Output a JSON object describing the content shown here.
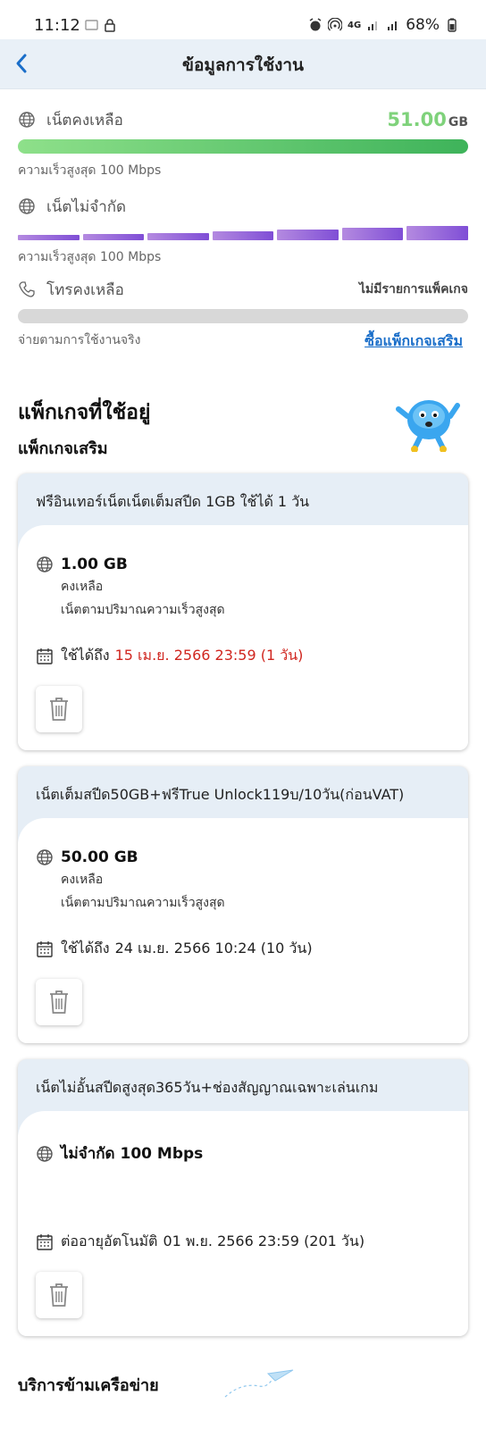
{
  "status_bar": {
    "time": "11:12",
    "battery": "68%",
    "network": "4G"
  },
  "header": {
    "title": "ข้อมูลการใช้งาน"
  },
  "usage": {
    "internet_remaining": {
      "label": "เน็ตคงเหลือ",
      "amount": "51.00",
      "unit": "GB",
      "speed": "ความเร็วสูงสุด 100 Mbps",
      "fill_fraction": 1.0
    },
    "unlimited": {
      "label": "เน็ตไม่จำกัด",
      "speed": "ความเร็วสูงสุด 100 Mbps"
    },
    "call_remaining": {
      "label": "โทรคงเหลือ",
      "status": "ไม่มีรายการแพ็คเกจ",
      "note": "จ่ายตามการใช้งานจริง",
      "buy_link": "ซื้อแพ็กเกจเสริม"
    }
  },
  "section": {
    "title": "แพ็กเกจที่ใช้อยู่",
    "subtitle": "แพ็กเกจเสริม"
  },
  "packages": [
    {
      "name": "ฟรีอินเทอร์เน็ตเน็ตเต็มสปีด  1GB ใช้ได้ 1 วัน",
      "amount": "1.00 GB",
      "remaining_label": "คงเหลือ",
      "desc": "เน็ตตามปริมาณความเร็วสูงสุด",
      "validity_label": "ใช้ได้ถึง",
      "validity_date": "15 เม.ย. 2566 23:59 (1 วัน)"
    },
    {
      "name": "เน็ตเต็มสปีด50GB+ฟรีTrue Unlock119บ/10วัน(ก่อนVAT)",
      "amount": "50.00 GB",
      "remaining_label": "คงเหลือ",
      "desc": "เน็ตตามปริมาณความเร็วสูงสุด",
      "validity_label": "ใช้ได้ถึง",
      "validity_date": "24 เม.ย. 2566 10:24 (10 วัน)"
    },
    {
      "name": "เน็ตไม่อั้นสปีดสูงสุด365วัน+ช่องสัญญาณเฉพาะเล่นเกม",
      "amount": "ไม่จำกัด 100 Mbps",
      "validity_label": "ต่ออายุอัตโนมัติ",
      "validity_date": "01 พ.ย. 2566 23:59 (201 วัน)"
    }
  ],
  "footer": {
    "title": "บริการข้ามเครือข่าย"
  },
  "colors": {
    "accent": "#1a6ec9",
    "green": "#3eb35a",
    "purple": "#7f4ed6",
    "expiry_red": "#d0261f"
  }
}
